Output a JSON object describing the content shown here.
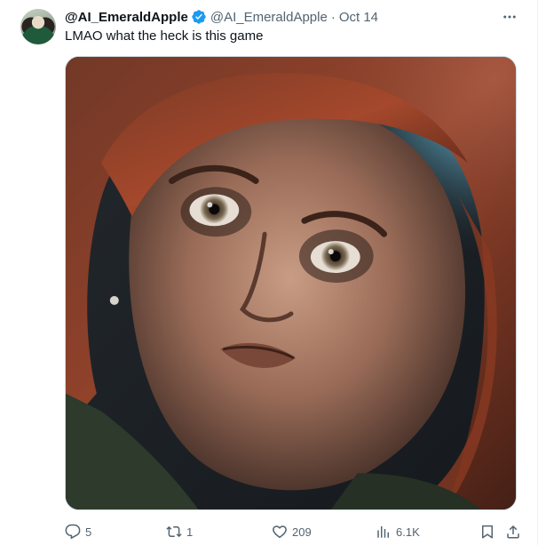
{
  "tweet": {
    "display_name": "@AI_EmeraldApple",
    "handle": "@AI_EmeraldApple",
    "separator": "·",
    "date": "Oct 14",
    "text": "LMAO what the heck is this game",
    "verified_color": "#1d9bf0"
  },
  "actions": {
    "replies": "5",
    "reposts": "1",
    "likes": "209",
    "views": "6.1K"
  },
  "icons": {
    "more": "more-icon",
    "reply": "reply-icon",
    "repost": "repost-icon",
    "like": "heart-icon",
    "views": "views-icon",
    "bookmark": "bookmark-icon",
    "share": "share-icon"
  }
}
